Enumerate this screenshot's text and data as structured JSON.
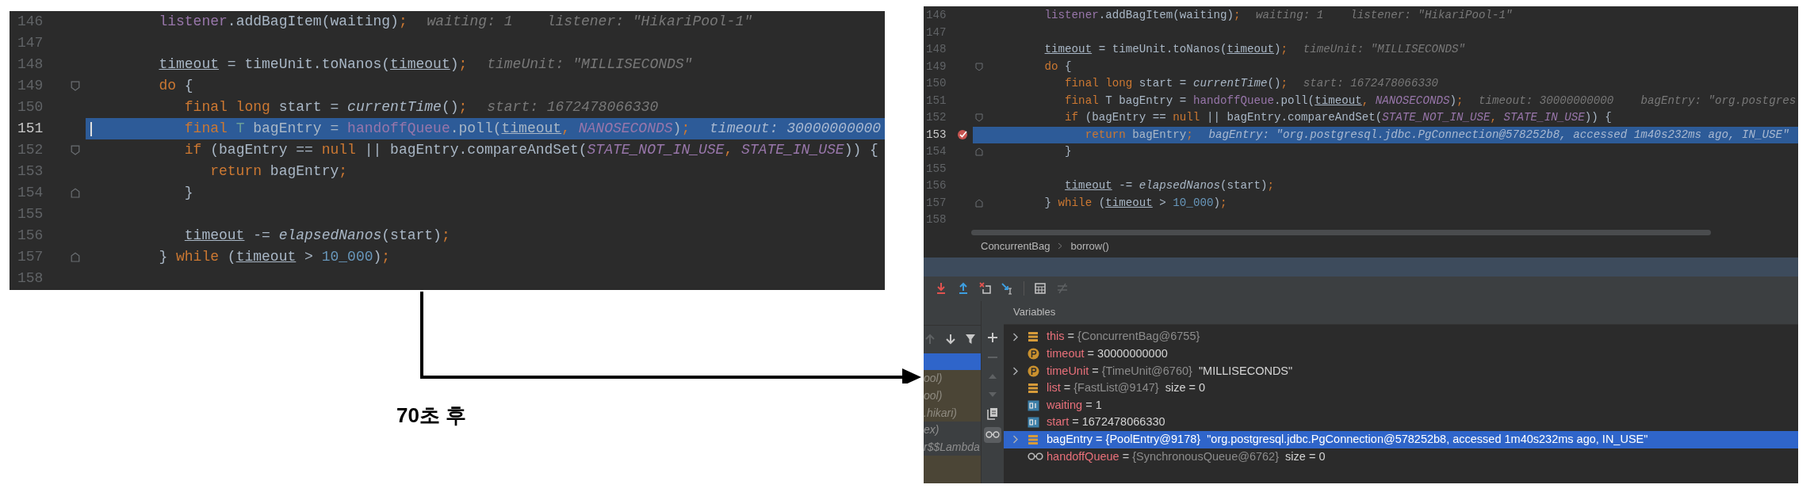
{
  "before": {
    "lines": [
      {
        "number": "146",
        "selected": false,
        "kind": "plain",
        "tokens": [
          {
            "text": "   listener",
            "kind": "field"
          },
          {
            "text": ".addBagItem(waiting)",
            "kind": "plain"
          },
          {
            "text": ";",
            "kind": "punct"
          }
        ],
        "hints": [
          "waiting: 1",
          "listener: \"HikariPool-1\""
        ]
      },
      {
        "number": "147",
        "selected": false,
        "kind": "plain"
      },
      {
        "number": "148",
        "selected": false,
        "kind": "plain",
        "tokens": [
          {
            "text": "   timeout",
            "kind": "underlined"
          },
          {
            "text": " = timeUnit.toNanos(",
            "kind": "plain"
          },
          {
            "text": "timeout",
            "kind": "underlined"
          },
          {
            "text": ")",
            "kind": "plain"
          },
          {
            "text": ";",
            "kind": "punct"
          }
        ],
        "hints": [
          "timeUnit: \"MILLISECONDS\""
        ]
      },
      {
        "number": "149",
        "selected": false,
        "kind": "fold-start",
        "tokens": [
          {
            "text": "   do",
            "kind": "keyword"
          },
          {
            "text": " {",
            "kind": "plain"
          }
        ]
      },
      {
        "number": "150",
        "selected": false,
        "kind": "plain",
        "tokens": [
          {
            "text": "      final long",
            "kind": "keyword"
          },
          {
            "text": " start = ",
            "kind": "plain"
          },
          {
            "text": "currentTime",
            "kind": "static"
          },
          {
            "text": "()",
            "kind": "plain"
          },
          {
            "text": ";",
            "kind": "punct"
          }
        ],
        "hints": [
          "start: 1672478066330"
        ]
      },
      {
        "number": "151",
        "selected": true,
        "kind": "plain",
        "tokens": [
          {
            "text": "      final ",
            "kind": "keyword"
          },
          {
            "text": "T",
            "kind": "type-param"
          },
          {
            "text": " bagEntry = ",
            "kind": "plain"
          },
          {
            "text": "handoffQueue",
            "kind": "field"
          },
          {
            "text": ".poll(",
            "kind": "plain"
          },
          {
            "text": "timeout",
            "kind": "underlined"
          },
          {
            "text": ", ",
            "kind": "punct"
          },
          {
            "text": "NANOSECONDS",
            "kind": "constant"
          },
          {
            "text": ")",
            "kind": "plain"
          },
          {
            "text": ";",
            "kind": "punct"
          }
        ],
        "hints": [
          "timeout: 30000000000"
        ]
      },
      {
        "number": "152",
        "selected": false,
        "kind": "fold-start",
        "tokens": [
          {
            "text": "      if",
            "kind": "keyword"
          },
          {
            "text": " (bagEntry == ",
            "kind": "plain"
          },
          {
            "text": "null",
            "kind": "keyword"
          },
          {
            "text": " || bagEntry.compareAndSet(",
            "kind": "plain"
          },
          {
            "text": "STATE_NOT_IN_USE",
            "kind": "constant"
          },
          {
            "text": ", ",
            "kind": "punct"
          },
          {
            "text": "STATE_IN_USE",
            "kind": "constant"
          },
          {
            "text": ")) {",
            "kind": "plain"
          }
        ]
      },
      {
        "number": "153",
        "selected": false,
        "kind": "plain",
        "tokens": [
          {
            "text": "         return",
            "kind": "keyword"
          },
          {
            "text": " bagEntry",
            "kind": "plain"
          },
          {
            "text": ";",
            "kind": "punct"
          }
        ]
      },
      {
        "number": "154",
        "selected": false,
        "kind": "fold-end",
        "tokens": [
          {
            "text": "      }",
            "kind": "plain"
          }
        ]
      },
      {
        "number": "155",
        "selected": false,
        "kind": "plain"
      },
      {
        "number": "156",
        "selected": false,
        "kind": "plain",
        "tokens": [
          {
            "text": "      timeout",
            "kind": "underlined"
          },
          {
            "text": " -= ",
            "kind": "plain"
          },
          {
            "text": "elapsedNanos",
            "kind": "static"
          },
          {
            "text": "(start)",
            "kind": "plain"
          },
          {
            "text": ";",
            "kind": "punct"
          }
        ]
      },
      {
        "number": "157",
        "selected": false,
        "kind": "fold-end",
        "tokens": [
          {
            "text": "   } ",
            "kind": "plain"
          },
          {
            "text": "while",
            "kind": "keyword"
          },
          {
            "text": " (",
            "kind": "plain"
          },
          {
            "text": "timeout",
            "kind": "underlined"
          },
          {
            "text": " > ",
            "kind": "plain"
          },
          {
            "text": "10_000",
            "kind": "number"
          },
          {
            "text": ")",
            "kind": "plain"
          },
          {
            "text": ";",
            "kind": "punct"
          }
        ]
      },
      {
        "number": "158",
        "selected": false,
        "kind": "plain"
      }
    ]
  },
  "transition": {
    "label": "70초 후"
  },
  "after": {
    "lines": [
      {
        "number": "146",
        "selected": false,
        "breakpoint": false,
        "kind": "plain",
        "tokens": [
          {
            "text": "   listener",
            "kind": "field"
          },
          {
            "text": ".addBagItem(waiting)",
            "kind": "plain"
          },
          {
            "text": ";",
            "kind": "punct"
          }
        ],
        "hints": [
          "waiting: 1",
          "listener: \"HikariPool-1\""
        ]
      },
      {
        "number": "147",
        "selected": false,
        "breakpoint": false,
        "kind": "plain"
      },
      {
        "number": "148",
        "selected": false,
        "breakpoint": false,
        "kind": "plain",
        "tokens": [
          {
            "text": "   timeout",
            "kind": "underlined"
          },
          {
            "text": " = timeUnit.toNanos(",
            "kind": "plain"
          },
          {
            "text": "timeout",
            "kind": "underlined"
          },
          {
            "text": ")",
            "kind": "plain"
          },
          {
            "text": ";",
            "kind": "punct"
          }
        ],
        "hints": [
          "timeUnit: \"MILLISECONDS\""
        ]
      },
      {
        "number": "149",
        "selected": false,
        "breakpoint": false,
        "kind": "fold-start",
        "tokens": [
          {
            "text": "   do",
            "kind": "keyword"
          },
          {
            "text": " {",
            "kind": "plain"
          }
        ]
      },
      {
        "number": "150",
        "selected": false,
        "breakpoint": false,
        "kind": "plain",
        "tokens": [
          {
            "text": "      final long",
            "kind": "keyword"
          },
          {
            "text": " start = ",
            "kind": "plain"
          },
          {
            "text": "currentTime",
            "kind": "static"
          },
          {
            "text": "()",
            "kind": "plain"
          },
          {
            "text": ";",
            "kind": "punct"
          }
        ],
        "hints": [
          "start: 1672478066330"
        ]
      },
      {
        "number": "151",
        "selected": false,
        "breakpoint": false,
        "kind": "plain",
        "tokens": [
          {
            "text": "      final",
            "kind": "keyword"
          },
          {
            "text": " T bagEntry = ",
            "kind": "plain"
          },
          {
            "text": "handoffQueue",
            "kind": "field"
          },
          {
            "text": ".poll(",
            "kind": "plain"
          },
          {
            "text": "timeout",
            "kind": "underlined"
          },
          {
            "text": ", ",
            "kind": "punct"
          },
          {
            "text": "NANOSECONDS",
            "kind": "constant"
          },
          {
            "text": ")",
            "kind": "plain"
          },
          {
            "text": ";",
            "kind": "punct"
          }
        ],
        "hints": [
          "timeout: 30000000000",
          "bagEntry: \"org.postgres"
        ]
      },
      {
        "number": "152",
        "selected": false,
        "breakpoint": false,
        "kind": "fold-start",
        "tokens": [
          {
            "text": "      if",
            "kind": "keyword"
          },
          {
            "text": " (bagEntry == ",
            "kind": "plain"
          },
          {
            "text": "null",
            "kind": "keyword"
          },
          {
            "text": " || bagEntry.compareAndSet(",
            "kind": "plain"
          },
          {
            "text": "STATE_NOT_IN_USE",
            "kind": "constant"
          },
          {
            "text": ", ",
            "kind": "punct"
          },
          {
            "text": "STATE_IN_USE",
            "kind": "constant"
          },
          {
            "text": ")) {",
            "kind": "plain"
          }
        ]
      },
      {
        "number": "153",
        "selected": true,
        "breakpoint": true,
        "kind": "plain",
        "tokens": [
          {
            "text": "         return",
            "kind": "keyword"
          },
          {
            "text": " bagEntry",
            "kind": "plain"
          },
          {
            "text": ";",
            "kind": "punct"
          }
        ],
        "hints": [
          "bagEntry: \"org.postgresql.jdbc.PgConnection@578252b8, accessed 1m40s232ms ago, IN_USE\""
        ]
      },
      {
        "number": "154",
        "selected": false,
        "breakpoint": false,
        "kind": "fold-end",
        "tokens": [
          {
            "text": "      }",
            "kind": "plain"
          }
        ]
      },
      {
        "number": "155",
        "selected": false,
        "breakpoint": false,
        "kind": "plain"
      },
      {
        "number": "156",
        "selected": false,
        "breakpoint": false,
        "kind": "plain",
        "tokens": [
          {
            "text": "      timeout",
            "kind": "underlined"
          },
          {
            "text": " -= ",
            "kind": "plain"
          },
          {
            "text": "elapsedNanos",
            "kind": "static"
          },
          {
            "text": "(start)",
            "kind": "plain"
          },
          {
            "text": ";",
            "kind": "punct"
          }
        ]
      },
      {
        "number": "157",
        "selected": false,
        "breakpoint": false,
        "kind": "fold-end",
        "tokens": [
          {
            "text": "   } ",
            "kind": "plain"
          },
          {
            "text": "while",
            "kind": "keyword"
          },
          {
            "text": " (",
            "kind": "plain"
          },
          {
            "text": "timeout",
            "kind": "underlined"
          },
          {
            "text": " > ",
            "kind": "plain"
          },
          {
            "text": "10_000",
            "kind": "number"
          },
          {
            "text": ")",
            "kind": "plain"
          },
          {
            "text": ";",
            "kind": "punct"
          }
        ]
      },
      {
        "number": "158",
        "selected": false,
        "breakpoint": false,
        "kind": "plain"
      }
    ],
    "breadcrumbs": [
      "ConcurrentBag",
      "borrow()"
    ],
    "frames": [
      {
        "selected": true
      },
      {
        "text": "ool)",
        "selected": false,
        "kind": "library"
      },
      {
        "text": "ool)",
        "selected": false,
        "kind": "library"
      },
      {
        "text": ".hikari)",
        "selected": false,
        "kind": "library"
      },
      {
        "text": "ex)",
        "selected": false,
        "kind": "user"
      },
      {
        "text": "r$$Lambda",
        "selected": false,
        "kind": "user"
      }
    ],
    "variables_title": "Variables",
    "variables": [
      {
        "kind": "field",
        "expandable": true,
        "selected": false,
        "name": "this",
        "operator": "=",
        "type": "{ConcurrentBag@6755}"
      },
      {
        "kind": "parameter",
        "expandable": false,
        "selected": false,
        "name": "timeout",
        "operator": "=",
        "value": "30000000000"
      },
      {
        "kind": "parameter",
        "expandable": true,
        "selected": false,
        "name": "timeUnit",
        "operator": "=",
        "type": "{TimeUnit@6760}",
        "value": "\"MILLISECONDS\""
      },
      {
        "kind": "field",
        "expandable": false,
        "selected": false,
        "name": "list",
        "operator": "=",
        "type": "{FastList@9147}",
        "value": "size = 0"
      },
      {
        "kind": "local",
        "expandable": false,
        "selected": false,
        "name": "waiting",
        "operator": "=",
        "value": "1"
      },
      {
        "kind": "local",
        "expandable": false,
        "selected": false,
        "name": "start",
        "operator": "=",
        "value": "1672478066330"
      },
      {
        "kind": "field",
        "expandable": true,
        "selected": true,
        "name": "bagEntry",
        "operator": "=",
        "type": "{PoolEntry@9178}",
        "value": "\"org.postgresql.jdbc.PgConnection@578252b8, accessed 1m40s232ms ago, IN_USE\""
      },
      {
        "kind": "watch",
        "expandable": false,
        "selected": false,
        "name": "handoffQueue",
        "operator": "=",
        "type": "{SynchronousQueue@6762}",
        "value": "size = 0"
      }
    ]
  }
}
